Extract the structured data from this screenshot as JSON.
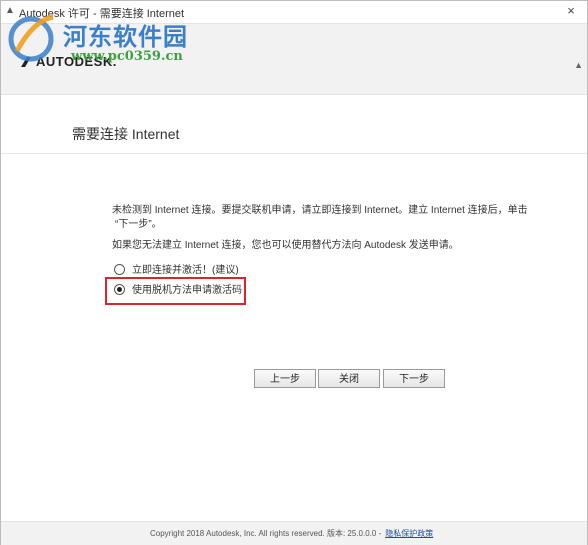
{
  "window": {
    "title": "Autodesk 许可 - 需要连接 Internet",
    "close_glyph": "×"
  },
  "header": {
    "logo_text": "AUTODESK."
  },
  "watermark": {
    "site_name": "河东软件园",
    "site_url": "www.pc0359.cn"
  },
  "main": {
    "page_title": "需要连接 Internet",
    "para1_line1": "未检测到 Internet 连接。要提交联机申请，请立即连接到 Internet。建立 Internet 连接后，单击",
    "para1_line2": "“下一步”。",
    "para2": "如果您无法建立 Internet 连接，您也可以使用替代方法向 Autodesk 发送申请。",
    "options": [
      {
        "label": "立即连接并激活！(建议)",
        "selected": false
      },
      {
        "label": "使用脱机方法申请激活码",
        "selected": true
      }
    ]
  },
  "buttons": {
    "back": "上一步",
    "close": "关闭",
    "next": "下一步"
  },
  "footer": {
    "copyright": "Copyright 2018 Autodesk, Inc. All rights reserved. 版本: 25.0.0.0 -",
    "privacy_link": "隐私保护政策"
  },
  "colors": {
    "highlight": "#d9262c",
    "watermark_blue": "#3b7fc8",
    "watermark_green": "#3da03d"
  }
}
